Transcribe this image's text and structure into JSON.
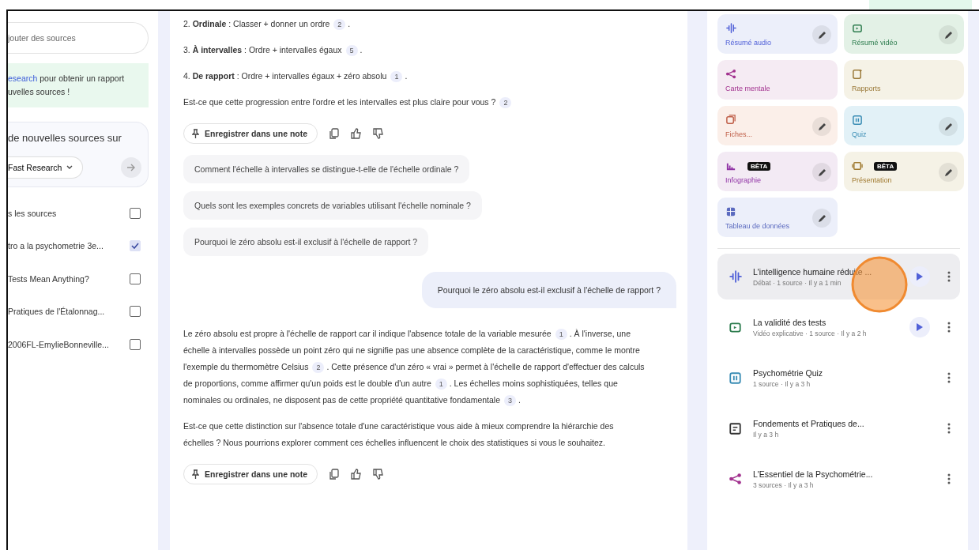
{
  "sources": {
    "add_placeholder": "jouter des sources",
    "banner": {
      "link": "esearch",
      "text": " pour obtenir un rapport",
      "line2": "uvelles sources !"
    },
    "search": {
      "prompt": "de nouvelles sources sur",
      "mode": "Fast Research"
    },
    "items": [
      {
        "title": "s les sources",
        "checked": false
      },
      {
        "title": "tro a la psychometrie 3e...",
        "checked": true
      },
      {
        "title": "Tests Mean Anything?",
        "checked": false
      },
      {
        "title": "Pratiques de l'Étalonnag...",
        "checked": false
      },
      {
        "title": "2006FL-EmylieBonneville...",
        "checked": false
      }
    ]
  },
  "chat": [
    {
      "kind": "paragraph",
      "segments": [
        {
          "text": "2. **Ordinale** : Classer + donner un ordre"
        },
        {
          "cite": "2"
        },
        {
          "text": "."
        }
      ]
    },
    {
      "kind": "paragraph",
      "segments": [
        {
          "text": "3. **À intervalles** : Ordre + intervalles égaux"
        },
        {
          "cite": "5"
        },
        {
          "text": "."
        }
      ]
    },
    {
      "kind": "paragraph",
      "segments": [
        {
          "text": "4. **De rapport** : Ordre + intervalles égaux + zéro absolu"
        },
        {
          "cite": "1"
        },
        {
          "text": "."
        }
      ]
    },
    {
      "kind": "paragraph",
      "segments": [
        {
          "text": "Est-ce que cette progression entre l'ordre et les intervalles est plus claire pour vous ?"
        },
        {
          "cite": "2"
        }
      ]
    },
    {
      "kind": "actions",
      "save_label": "Enregistrer dans une note"
    },
    {
      "kind": "suggestion",
      "text": "Comment l'échelle à intervalles se distingue-t-elle de l'échelle ordinale ?"
    },
    {
      "kind": "suggestion",
      "text": "Quels sont les exemples concrets de variables utilisant l'échelle nominale ?"
    },
    {
      "kind": "suggestion",
      "text": "Pourquoi le zéro absolu est-il exclusif à l'échelle de rapport ?"
    },
    {
      "kind": "user",
      "text": "Pourquoi le zéro absolu est-il exclusif à l'échelle de rapport ?"
    },
    {
      "kind": "paragraph",
      "segments": [
        {
          "text": "Le zéro absolu est propre à l'échelle de rapport car il indique l'absence totale de la variable mesurée"
        },
        {
          "cite": "1"
        },
        {
          "text": ". À l'inverse, une échelle à intervalles possède un point zéro qui ne signifie pas une absence complète de la caractéristique, comme le montre l'exemple du thermomètre Celsius"
        },
        {
          "cite": "2"
        },
        {
          "text": ". Cette présence d'un zéro « vrai » permet à l'échelle de rapport d'effectuer des calculs de proportions, comme affirmer qu'un poids est le double d'un autre"
        },
        {
          "cite": "1"
        },
        {
          "text": ". Les échelles moins sophistiquées, telles que nominales ou ordinales, ne disposent pas de cette propriété quantitative fondamentale"
        },
        {
          "cite": "3"
        },
        {
          "text": "."
        }
      ]
    },
    {
      "kind": "paragraph",
      "segments": [
        {
          "text": "Est-ce que cette distinction sur l'absence totale d'une caractéristique vous aide à mieux comprendre la hiérarchie des échelles ? Nous pourrions explorer comment ces échelles influencent le choix des statistiques si vous le souhaitez."
        }
      ]
    },
    {
      "kind": "actions",
      "save_label": "Enregistrer dans une note"
    }
  ],
  "studio": {
    "tiles": [
      {
        "kind": "audio",
        "label": "Résumé audio",
        "color": "#eceffa",
        "editable": true,
        "beta": false
      },
      {
        "kind": "video",
        "label": "Résumé vidéo",
        "color": "#e3f1e6",
        "editable": true,
        "beta": false
      },
      {
        "kind": "mindmap",
        "label": "Carte mentale",
        "color": "#f5ebf3",
        "editable": false,
        "beta": false
      },
      {
        "kind": "report",
        "label": "Rapports",
        "color": "#f5f2e6",
        "editable": false,
        "beta": false
      },
      {
        "kind": "flashcards",
        "label": "Fiches...",
        "color": "#fbefe9",
        "editable": true,
        "beta": false
      },
      {
        "kind": "quiz",
        "label": "Quiz",
        "color": "#e2f1f7",
        "editable": true,
        "beta": false
      },
      {
        "kind": "infographic",
        "label": "Infographie",
        "color": "#f3eaf4",
        "editable": true,
        "beta": true,
        "badge": "BÊTA"
      },
      {
        "kind": "slides",
        "label": "Présentation",
        "color": "#f5f2e6",
        "editable": true,
        "beta": true,
        "badge": "BÊTA"
      },
      {
        "kind": "table",
        "label": "Tableau de données",
        "color": "#eceffa",
        "editable": true,
        "beta": false
      }
    ],
    "notes": [
      {
        "kind": "audio",
        "title": "L'intelligence humaine réduite ...",
        "meta": "Débat · 1 source · Il y a 1 min",
        "playable": true,
        "selected": true
      },
      {
        "kind": "video",
        "title": "La validité des tests",
        "meta": "Vidéo explicative · 1 source · Il y a 2 h",
        "playable": true,
        "selected": false
      },
      {
        "kind": "quiz",
        "title": "Psychométrie Quiz",
        "meta": "1 source · Il y a 3 h",
        "playable": false,
        "selected": false
      },
      {
        "kind": "note",
        "title": "Fondements et Pratiques de...",
        "meta": "Il y a 3 h",
        "playable": false,
        "selected": false
      },
      {
        "kind": "mindmap",
        "title": "L'Essentiel de la Psychométrie...",
        "meta": "3 sources · Il y a 3 h",
        "playable": false,
        "selected": false
      }
    ]
  },
  "click_marker": true
}
